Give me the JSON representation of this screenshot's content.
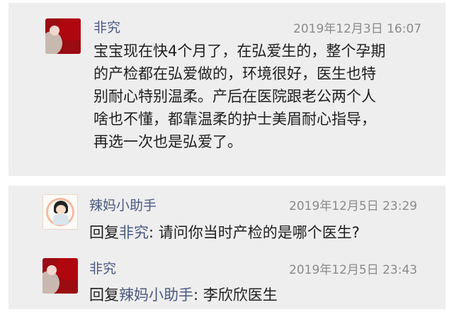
{
  "comments": [
    {
      "author": "非究",
      "time": "2019年12月3日 16:07",
      "lines": [
        "宝宝现在快4个月了，在弘爱生的，整个孕期",
        "的产检都在弘爱做的，环境很好，医生也特",
        "别耐心特别温柔。产后在医院跟老公两个人",
        "啥也不懂，都靠温柔的护士美眉耐心指导，",
        "再选一次也是弘爱了。"
      ]
    }
  ],
  "replies": [
    {
      "author": "辣妈小助手",
      "time": "2019年12月5日 23:29",
      "prefix": "回复",
      "target": "非究",
      "text": ": 请问你当时产检的是哪个医生?"
    },
    {
      "author": "非究",
      "time": "2019年12月5日 23:43",
      "prefix": "回复",
      "target": "辣妈小助手",
      "text": ": 李欣欣医生"
    }
  ],
  "colors": {
    "name": "#4a5a82",
    "time": "#8a8a8a",
    "card_bg": "#eeeeee"
  }
}
